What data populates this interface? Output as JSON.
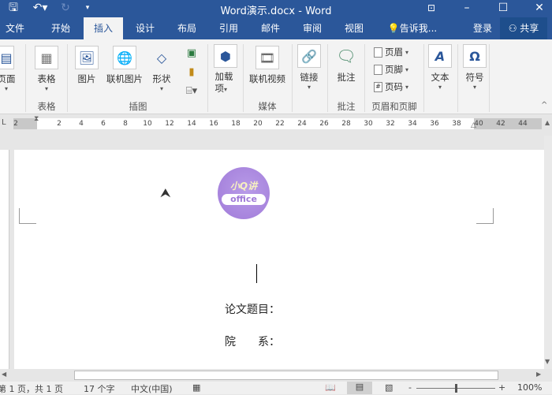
{
  "window": {
    "title": "Word演示.docx - Word"
  },
  "titlebar": {
    "save_icon": "save-icon",
    "undo_icon": "undo-icon",
    "redo_icon": "redo-icon",
    "restore_ribbon_icon": "ribbon-display-icon"
  },
  "tabs": [
    {
      "label": "文件"
    },
    {
      "label": "开始"
    },
    {
      "label": "插入",
      "active": true
    },
    {
      "label": "设计"
    },
    {
      "label": "布局"
    },
    {
      "label": "引用"
    },
    {
      "label": "邮件"
    },
    {
      "label": "审阅"
    },
    {
      "label": "视图"
    }
  ],
  "tell_me": "告诉我...",
  "login": "登录",
  "share": "共享",
  "ribbon": {
    "pages": "页面",
    "table": "表格",
    "picture": "图片",
    "online_picture": "联机图片",
    "shapes": "形状",
    "addins": "加载项",
    "addins2": "项",
    "addins1": "加载",
    "online_video": "联机视频",
    "link": "链接",
    "comment": "批注",
    "header": "页眉",
    "footer": "页脚",
    "page_number": "页码",
    "text": "文本",
    "symbol": "符号",
    "symbol_glyph": "Ω",
    "text_glyph": "A",
    "groups": {
      "table": "表格",
      "illustrations": "插图",
      "media": "媒体",
      "comments": "批注",
      "header_footer": "页眉和页脚"
    }
  },
  "ruler": {
    "left": [
      "2"
    ],
    "ticks": [
      "2",
      "4",
      "6",
      "8",
      "10",
      "12",
      "14",
      "16",
      "18",
      "20",
      "22",
      "24",
      "26",
      "28",
      "30",
      "32",
      "34",
      "36",
      "38",
      "40",
      "42",
      "44"
    ]
  },
  "document": {
    "logo_text": "小Q讲 office",
    "line1": "论文题目：",
    "line2_a": "院",
    "line2_b": "系："
  },
  "status": {
    "page": "第 1 页，共 1 页",
    "words": "17 个字",
    "language": "中文(中国)",
    "zoom": "100%",
    "zoom_level": 100,
    "zoom_minus": "-",
    "zoom_plus": "+"
  },
  "colors": {
    "accent": "#2b579a",
    "ribbon": "#f3f3f3"
  }
}
